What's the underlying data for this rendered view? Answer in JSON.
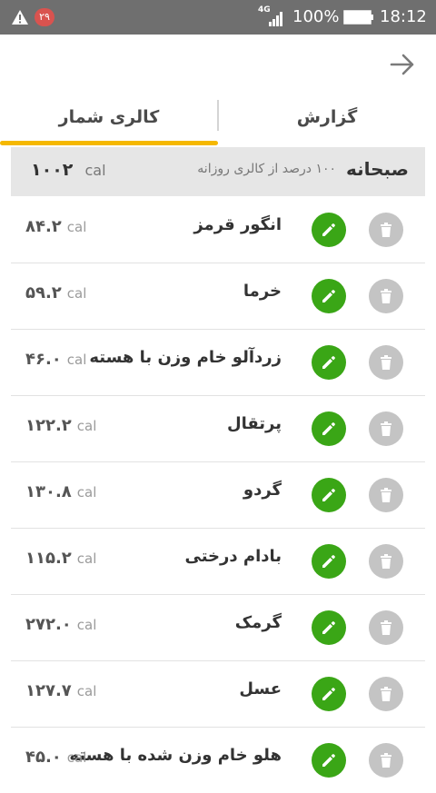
{
  "status_bar": {
    "notification_badge": "۲۹",
    "network": "4G",
    "battery_percent": "100%",
    "time": "18:12",
    "icons": [
      "warning-icon",
      "signal-icon",
      "battery-icon"
    ]
  },
  "header": {
    "back_icon": "arrow-right-icon"
  },
  "tabs": [
    {
      "label": "گزارش",
      "active": false
    },
    {
      "label": "کالری شمار",
      "active": true
    }
  ],
  "colors": {
    "accent": "#f5b800",
    "edit_button": "#3aa616",
    "delete_button": "#c4c4c4",
    "status_bar": "#6f6f6f",
    "section_bg": "#e6e6e6"
  },
  "meal_section": {
    "title": "صبحانه",
    "percent_text": "۱۰۰ درصد از کالری روزانه",
    "total": "۱۰۰۲",
    "unit": "cal"
  },
  "items": [
    {
      "name": "انگور قرمز",
      "calories": "۸۴.۲",
      "unit": "cal"
    },
    {
      "name": "خرما",
      "calories": "۵۹.۲",
      "unit": "cal"
    },
    {
      "name": "زردآلو خام وزن با هسته",
      "calories": "۴۶.۰",
      "unit": "cal"
    },
    {
      "name": "پرتقال",
      "calories": "۱۲۲.۲",
      "unit": "cal"
    },
    {
      "name": "گردو",
      "calories": "۱۳۰.۸",
      "unit": "cal"
    },
    {
      "name": "بادام درختی",
      "calories": "۱۱۵.۲",
      "unit": "cal"
    },
    {
      "name": "گرمک",
      "calories": "۲۷۲.۰",
      "unit": "cal"
    },
    {
      "name": "عسل",
      "calories": "۱۲۷.۷",
      "unit": "cal"
    },
    {
      "name": "هلو خام وزن شده با هسته",
      "calories": "۴۵.۰",
      "unit": "cal"
    }
  ]
}
